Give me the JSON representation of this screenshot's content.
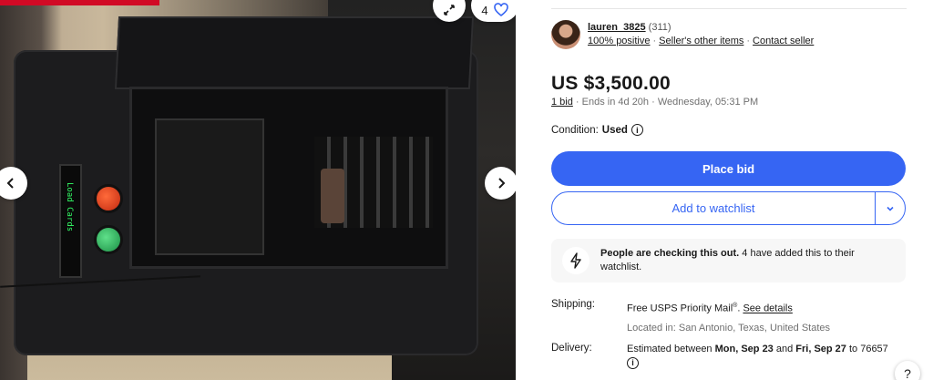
{
  "gallery": {
    "image_count": "4",
    "icons": [
      "chevron-left-icon",
      "chevron-right-icon",
      "expand-icon",
      "heart-icon"
    ],
    "device_display_text": "Load Cards"
  },
  "seller": {
    "name": "lauren_3825",
    "score": "(311)",
    "positive": "100% positive",
    "other_items": "Seller's other items",
    "contact": "Contact seller"
  },
  "listing": {
    "price": "US $3,500.00",
    "bids": "1 bid",
    "ends": "Ends in 4d 20h",
    "ends_date": "Wednesday, 05:31 PM",
    "condition_label": "Condition:",
    "condition_value": "Used"
  },
  "actions": {
    "place_bid": "Place bid",
    "add_watchlist": "Add to watchlist"
  },
  "alert": {
    "bold": "People are checking this out.",
    "text": "4 have added this to their watchlist."
  },
  "shipping": {
    "label": "Shipping:",
    "value": "Free USPS Priority Mail",
    "sup": "®",
    "link": "See details",
    "location": "Located in: San Antonio, Texas, United States"
  },
  "delivery": {
    "label": "Delivery:",
    "prefix": "Estimated between ",
    "start": "Mon, Sep 23",
    "mid": " and ",
    "end": "Fri, Sep 27",
    "suffix": " to 76657"
  },
  "colors": {
    "primary": "#3665f3",
    "text": "#191919",
    "muted": "#707070"
  },
  "help": "?"
}
